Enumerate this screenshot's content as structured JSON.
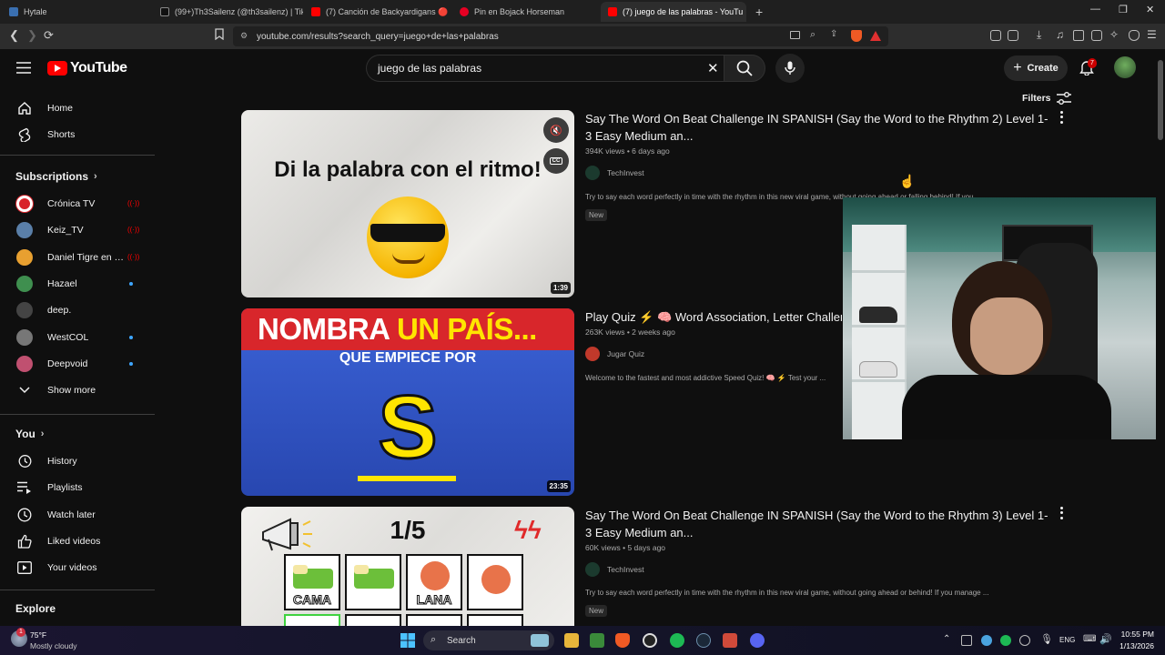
{
  "browser": {
    "tabs": [
      {
        "title": "Hytale",
        "fav_color": "#3a6fb0"
      },
      {
        "title": "(99+)Th3Sailenz (@th3sailenz) | TikTo",
        "fav_color": "#111111"
      },
      {
        "title": "(7) Canción de Backyardigans 🔴 - Yo",
        "fav_color": "#ff0000"
      },
      {
        "title": "Pin en Bojack Horseman",
        "fav_color": "#e60023"
      },
      {
        "title": "(7) juego de las palabras - YouTu",
        "fav_color": "#ff0000",
        "active": true
      }
    ],
    "new_tab": "+",
    "url": "youtube.com/results?search_query=juego+de+las+palabras"
  },
  "header": {
    "logo_text": "YouTube",
    "search_value": "juego de las palabras",
    "create_label": "Create",
    "notification_count": "7",
    "filters_label": "Filters"
  },
  "sidebar": {
    "main": [
      {
        "label": "Home",
        "icon": "home-icon"
      },
      {
        "label": "Shorts",
        "icon": "shorts-icon"
      }
    ],
    "subscriptions_title": "Subscriptions",
    "subscriptions": [
      {
        "label": "Crónica TV",
        "color": "#d8232a",
        "status": "live"
      },
      {
        "label": "Keiz_TV",
        "color": "#5a7fa8",
        "status": "live"
      },
      {
        "label": "Daniel Tigre en E...",
        "color": "#e8a030",
        "status": "live"
      },
      {
        "label": "Hazael",
        "color": "#3f8f4f",
        "status": "new"
      },
      {
        "label": "deep.",
        "color": "#444444",
        "status": ""
      },
      {
        "label": "WestCOL",
        "color": "#777777",
        "status": "new"
      },
      {
        "label": "Deepvoid",
        "color": "#c05070",
        "status": "new"
      }
    ],
    "show_more": "Show more",
    "you_title": "You",
    "you_items": [
      {
        "label": "History",
        "icon": "history-icon"
      },
      {
        "label": "Playlists",
        "icon": "playlists-icon"
      },
      {
        "label": "Watch later",
        "icon": "watch-later-icon"
      },
      {
        "label": "Liked videos",
        "icon": "like-icon"
      },
      {
        "label": "Your videos",
        "icon": "your-videos-icon"
      }
    ],
    "explore_title": "Explore"
  },
  "results": [
    {
      "thumb_text": "Di la palabra con el ritmo!",
      "duration": "1:39",
      "title": "Say The Word On Beat Challenge IN SPANISH (Say the Word to the Rhythm 2) Level 1-3 Easy Medium an...",
      "meta": "394K views • 6 days ago",
      "channel": "TechInvest",
      "channel_color": "#1b3a2e",
      "description": "Try to say each word perfectly in time with the rhythm in this new viral game, without going ahead or falling behind! If you ...",
      "badge": "New"
    },
    {
      "thumb_line1a": "NOMBRA",
      "thumb_line1b": "UN PAÍS...",
      "thumb_line2": "QUE EMPIECE POR",
      "thumb_letter": "S",
      "duration": "23:35",
      "title": "Play Quiz ⚡ 🧠 Word Association, Letter Challenge ...",
      "meta": "263K views • 2 weeks ago",
      "channel": "Jugar Quiz",
      "channel_color": "#c0392b",
      "description": "Welcome to the fastest and most addictive Speed Quiz! 🧠 ⚡ Test your ..."
    },
    {
      "thumb_counter": "1/5",
      "thumb_words": [
        "CAMA",
        "LANA"
      ],
      "title": "Say The Word On Beat Challenge IN SPANISH (Say the Word to the Rhythm 3) Level 1-3 Easy Medium an...",
      "meta": "60K views • 5 days ago",
      "channel": "TechInvest",
      "channel_color": "#1b3a2e",
      "description": "Try to say each word perfectly in time with the rhythm in this new viral game, without going ahead or behind! If you manage ...",
      "badge": "New"
    }
  ],
  "taskbar": {
    "weather_temp": "75°F",
    "weather_desc": "Mostly cloudy",
    "weather_badge": "1",
    "search_label": "Search",
    "lang": "ENG",
    "time": "10:55 PM",
    "date": "1/13/2026"
  }
}
